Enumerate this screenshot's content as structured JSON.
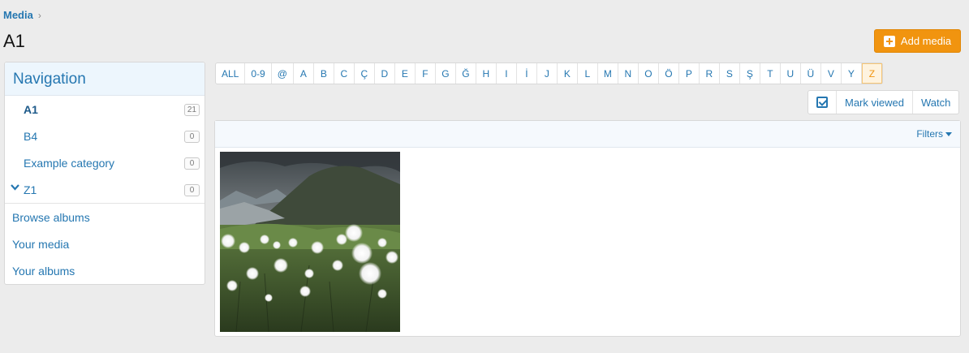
{
  "breadcrumb": {
    "root": "Media",
    "separator": "›"
  },
  "page": {
    "title": "A1"
  },
  "add_media": {
    "label": "Add media",
    "icon": "plus-square-icon"
  },
  "sidebar": {
    "title": "Navigation",
    "categories": [
      {
        "label": "A1",
        "count": "21",
        "active": true
      },
      {
        "label": "B4",
        "count": "0"
      },
      {
        "label": "Example category",
        "count": "0"
      },
      {
        "label": "Z1",
        "count": "0",
        "expand_icon": "chevron-down-icon"
      }
    ],
    "links": [
      {
        "label": "Browse albums"
      },
      {
        "label": "Your media"
      },
      {
        "label": "Your albums"
      }
    ]
  },
  "letters": [
    "ALL",
    "0-9",
    "@",
    "A",
    "B",
    "C",
    "Ç",
    "D",
    "E",
    "F",
    "G",
    "Ğ",
    "H",
    "I",
    "İ",
    "J",
    "K",
    "L",
    "M",
    "N",
    "O",
    "Ö",
    "P",
    "R",
    "S",
    "Ş",
    "T",
    "U",
    "Ü",
    "V",
    "Y",
    "Z"
  ],
  "selected_letter": "Z",
  "actions": {
    "select_icon": "checkbox-icon",
    "mark_viewed": "Mark viewed",
    "watch": "Watch"
  },
  "panel": {
    "filters_label": "Filters"
  },
  "colors": {
    "accent": "#2577b1",
    "button_orange": "#f1940f",
    "background": "#ececec"
  }
}
